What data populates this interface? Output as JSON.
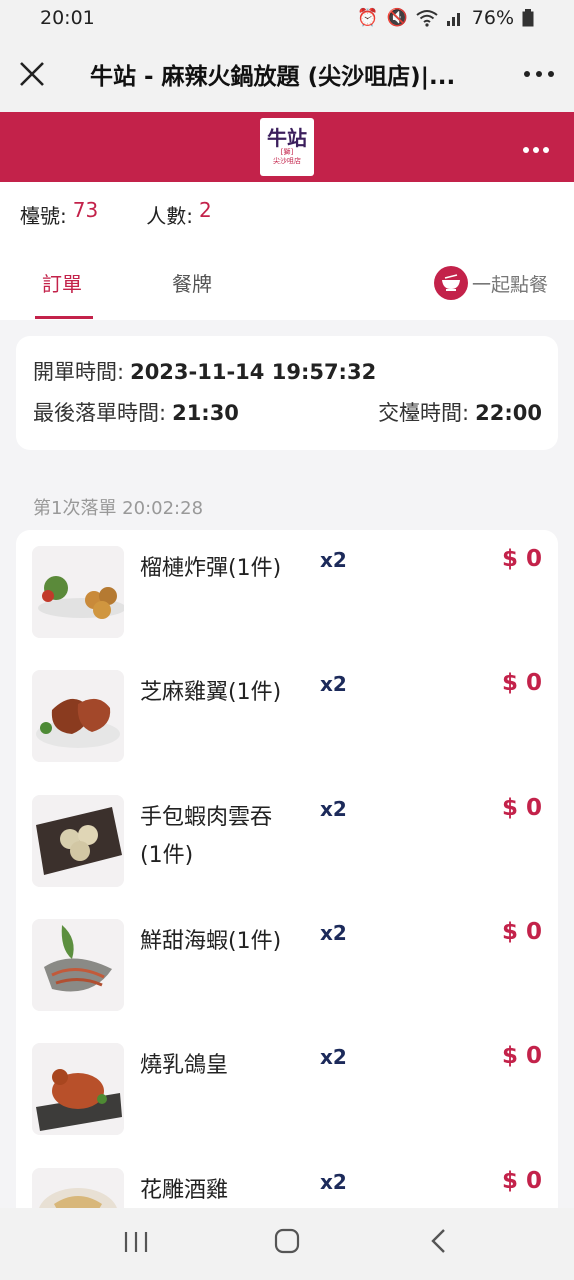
{
  "status_bar": {
    "time": "20:01",
    "battery": "76%",
    "icons": [
      "alarm-icon",
      "mute-icon",
      "wifi-icon",
      "volte-icon",
      "signal-icon",
      "battery-icon"
    ]
  },
  "title_bar": {
    "title": "牛站 - 麻辣火鍋放題 (尖沙咀店)|...",
    "close_icon": "close-icon",
    "more_icon": "more-icon"
  },
  "brand": {
    "logo_text": "牛站",
    "logo_suffix": "[獅]",
    "logo_sub": "尖沙咀店",
    "accent": "#c3224a"
  },
  "table_info": {
    "table_label": "檯號:",
    "table_value": "73",
    "people_label": "人數:",
    "people_value": "2"
  },
  "tabs": {
    "order": "訂單",
    "menu": "餐牌",
    "together": "一起點餐"
  },
  "times": {
    "open_label": "開單時間:",
    "open_value": "2023-11-14 19:57:32",
    "last_order_label": "最後落單時間:",
    "last_order_value": "21:30",
    "hand_over_label": "交檯時間:",
    "hand_over_value": "22:00"
  },
  "batch": {
    "label": "第1次落單 20:02:28"
  },
  "items": [
    {
      "name": "榴槤炸彈(1件)",
      "qty": "x2",
      "price": "$ 0"
    },
    {
      "name": "芝麻雞翼(1件)",
      "qty": "x2",
      "price": "$ 0"
    },
    {
      "name": "手包蝦肉雲吞(1件)",
      "qty": "x2",
      "price": "$ 0"
    },
    {
      "name": "鮮甜海蝦(1件)",
      "qty": "x2",
      "price": "$ 0"
    },
    {
      "name": "燒乳鴿皇",
      "qty": "x2",
      "price": "$ 0"
    },
    {
      "name": "花雕酒雞",
      "qty": "x2",
      "price": "$ 0"
    }
  ],
  "nav_bar": {
    "recents": "|||",
    "home": "◯",
    "back": "‹"
  }
}
